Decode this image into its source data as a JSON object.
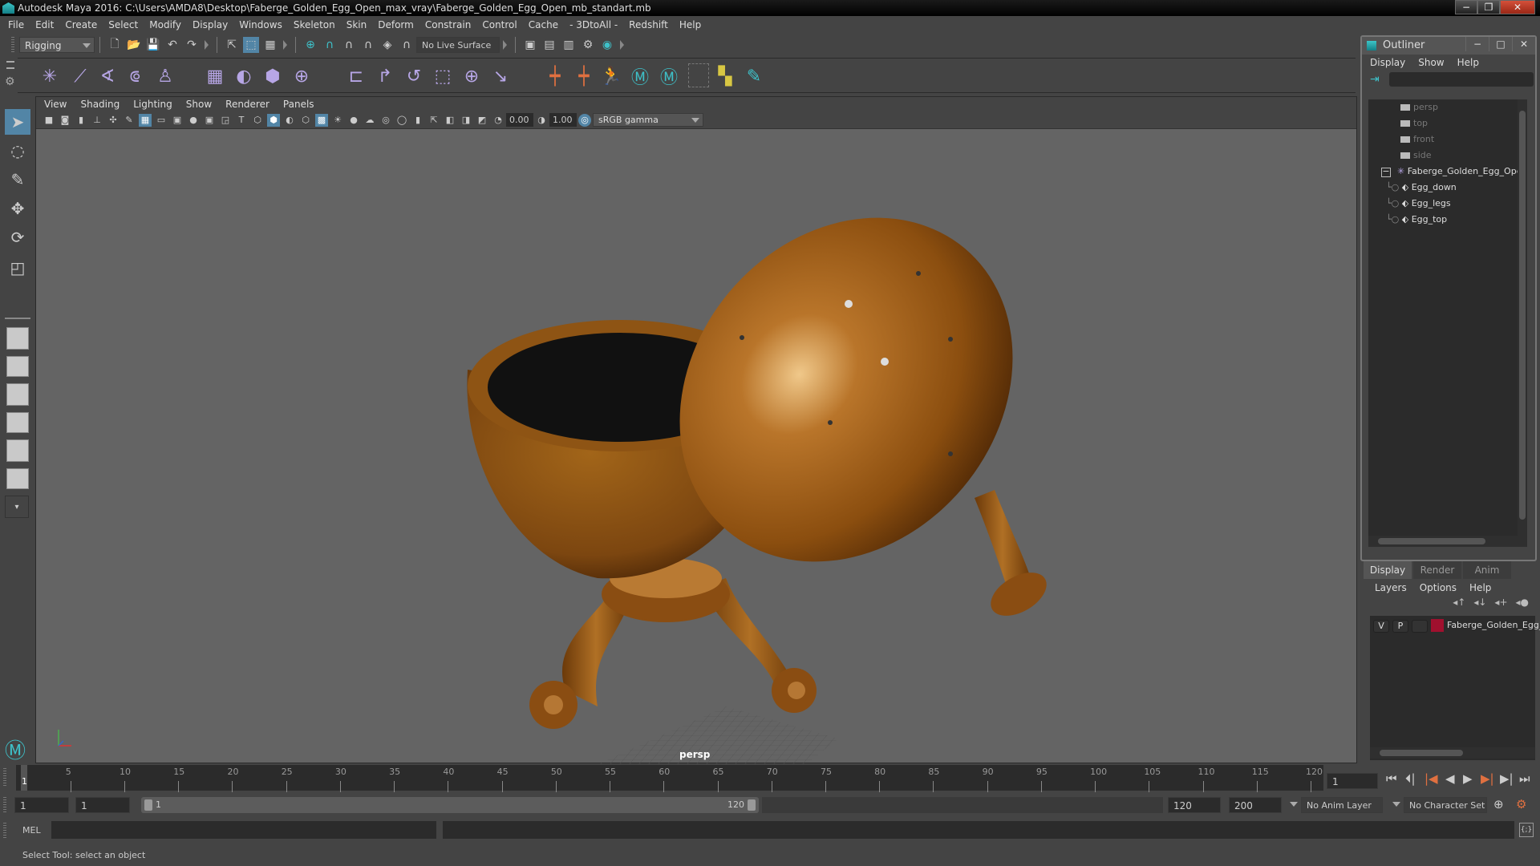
{
  "window": {
    "title": "Autodesk Maya 2016: C:\\Users\\AMDA8\\Desktop\\Faberge_Golden_Egg_Open_max_vray\\Faberge_Golden_Egg_Open_mb_standart.mb",
    "minimize": "−",
    "restore": "❐",
    "close": "✕"
  },
  "menubar": [
    "File",
    "Edit",
    "Create",
    "Select",
    "Modify",
    "Display",
    "Windows",
    "Skeleton",
    "Skin",
    "Deform",
    "Constrain",
    "Control",
    "Cache",
    "- 3DtoAll -",
    "Redshift",
    "Help"
  ],
  "statusline": {
    "mode": "Rigging",
    "live_surface": "No Live Surface"
  },
  "viewport": {
    "menu": [
      "View",
      "Shading",
      "Lighting",
      "Show",
      "Renderer",
      "Panels"
    ],
    "exposure": "0.00",
    "gamma": "1.00",
    "color_space": "sRGB gamma",
    "camera_label": "persp"
  },
  "outliner": {
    "title": "Outliner",
    "menu": [
      "Display",
      "Show",
      "Help"
    ],
    "items": [
      {
        "label": "persp",
        "type": "camera"
      },
      {
        "label": "top",
        "type": "camera"
      },
      {
        "label": "front",
        "type": "camera"
      },
      {
        "label": "side",
        "type": "camera"
      },
      {
        "label": "Faberge_Golden_Egg_Open",
        "type": "group"
      },
      {
        "label": "Egg_down",
        "type": "mesh"
      },
      {
        "label": "Egg_legs",
        "type": "mesh"
      },
      {
        "label": "Egg_top",
        "type": "mesh"
      }
    ]
  },
  "layers": {
    "tabs": [
      "Display",
      "Render",
      "Anim"
    ],
    "menu": [
      "Layers",
      "Options",
      "Help"
    ],
    "rows": [
      {
        "v": "V",
        "p": "P",
        "color": "#a0102e",
        "name": "Faberge_Golden_Egg_"
      }
    ]
  },
  "timeline": {
    "ticks": [
      "5",
      "10",
      "15",
      "20",
      "25",
      "30",
      "35",
      "40",
      "45",
      "50",
      "55",
      "60",
      "65",
      "70",
      "75",
      "80",
      "85",
      "90",
      "95",
      "100",
      "105",
      "110",
      "115",
      "120"
    ],
    "current": "1",
    "current_frame_field": "1"
  },
  "range": {
    "start": "1",
    "playback_start": "1",
    "slider_start": "1",
    "slider_end": "120",
    "playback_end": "120",
    "end": "200",
    "anim_layer": "No Anim Layer",
    "character_set": "No Character Set"
  },
  "cmdline": {
    "label": "MEL"
  },
  "helpline": {
    "text": "Select Tool: select an object"
  }
}
